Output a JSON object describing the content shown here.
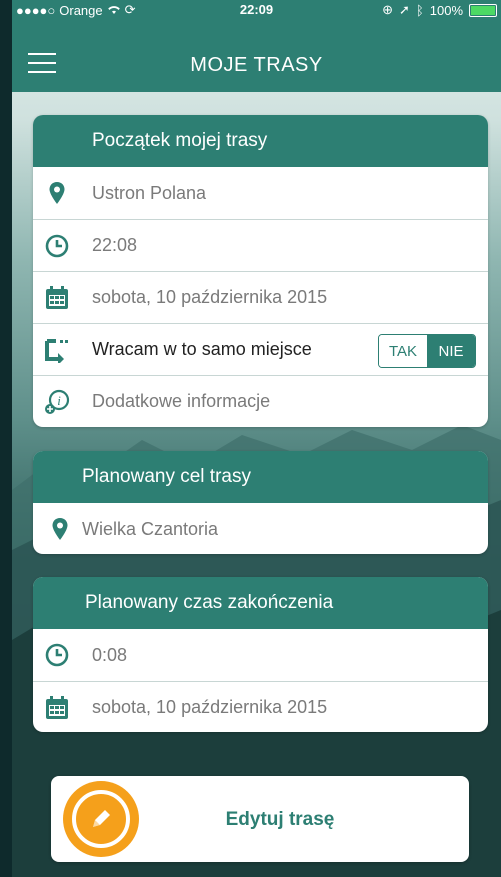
{
  "status": {
    "signal": "●●●●○",
    "carrier": "Orange",
    "time": "22:09",
    "battery": "100%"
  },
  "nav": {
    "title": "MOJE TRASY",
    "menu_icon": "hamburger-icon"
  },
  "start_card": {
    "title": "Początek mojej trasy",
    "location": "Ustron Polana",
    "time": "22:08",
    "date": "sobota, 10 października 2015",
    "return_label": "Wracam w to samo miejsce",
    "toggle_yes": "TAK",
    "toggle_no": "NIE",
    "toggle_selected": "NIE",
    "more_info": "Dodatkowe informacje"
  },
  "destination_card": {
    "title": "Planowany cel trasy",
    "location": "Wielka Czantoria"
  },
  "end_card": {
    "title": "Planowany czas zakończenia",
    "time": "0:08",
    "date": "sobota, 10 października 2015"
  },
  "edit_button": {
    "label": "Edytuj trasę"
  },
  "colors": {
    "primary": "#2d7f73",
    "accent": "#f5a01b"
  }
}
